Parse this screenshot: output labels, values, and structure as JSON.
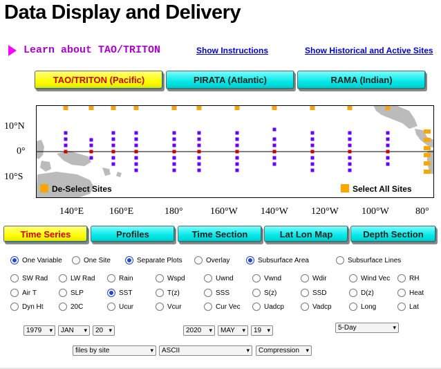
{
  "page_title": "Data Display and Delivery",
  "learn_label": "Learn about TAO/TRITON",
  "links": {
    "instructions": "Show Instructions",
    "historical": "Show Historical and Active Sites"
  },
  "array_tabs": [
    {
      "label": "TAO/TRITON (Pacific)",
      "selected": true
    },
    {
      "label": "PIRATA (Atlantic)",
      "selected": false
    },
    {
      "label": "RAMA (Indian)",
      "selected": false
    }
  ],
  "map": {
    "lat_labels": [
      "10°N",
      "0°",
      "10°S"
    ],
    "lon_labels": [
      "140°E",
      "160°E",
      "180°",
      "160°W",
      "140°W",
      "120°W",
      "100°W",
      "80°"
    ],
    "deselect_label": "De-Select Sites",
    "select_all_label": "Select All Sites",
    "colors": {
      "site": "#6600ff",
      "selector": "#ffa500",
      "equator_site": "#cc0000",
      "land": "#bbbbbb"
    }
  },
  "display_tabs": [
    {
      "label": "Time Series",
      "selected": true
    },
    {
      "label": "Profiles",
      "selected": false
    },
    {
      "label": "Time Section",
      "selected": false
    },
    {
      "label": "Lat Lon Map",
      "selected": false
    },
    {
      "label": "Depth Section",
      "selected": false
    }
  ],
  "mode_options": {
    "one_variable": "One Variable",
    "one_site": "One Site",
    "separate_plots": "Separate Plots",
    "overlay": "Overlay",
    "subsurface_area": "Subsurface Area",
    "subsurface_lines": "Subsurface Lines"
  },
  "variables": {
    "sw_rad": "SW Rad",
    "lw_rad": "LW Rad",
    "rain": "Rain",
    "wspd": "Wspd",
    "uwnd": "Uwnd",
    "vwnd": "Vwnd",
    "wdir": "Wdir",
    "wind_vec": "Wind Vec",
    "rh": "RH",
    "air_t": "Air T",
    "slp": "SLP",
    "sst": "SST",
    "tz": "T(z)",
    "sss": "SSS",
    "sz": "S(z)",
    "ssd": "SSD",
    "dz": "D(z)",
    "heat": "Heat",
    "dyn_ht": "Dyn Ht",
    "d20c": "20C",
    "ucur": "Ucur",
    "vcur": "Vcur",
    "cur_vec": "Cur Vec",
    "uadcp": "Uadcp",
    "vadcp": "Vadcp",
    "long": "Long",
    "lat": "Lat"
  },
  "dates": {
    "start_year": "1979",
    "start_month": "JAN",
    "start_day": "20",
    "end_year": "2020",
    "end_month": "MAY",
    "end_day": "19",
    "averaging": "5-Day"
  },
  "delivery": {
    "grouping": "files by site",
    "format": "ASCII",
    "compression": "Compression"
  }
}
